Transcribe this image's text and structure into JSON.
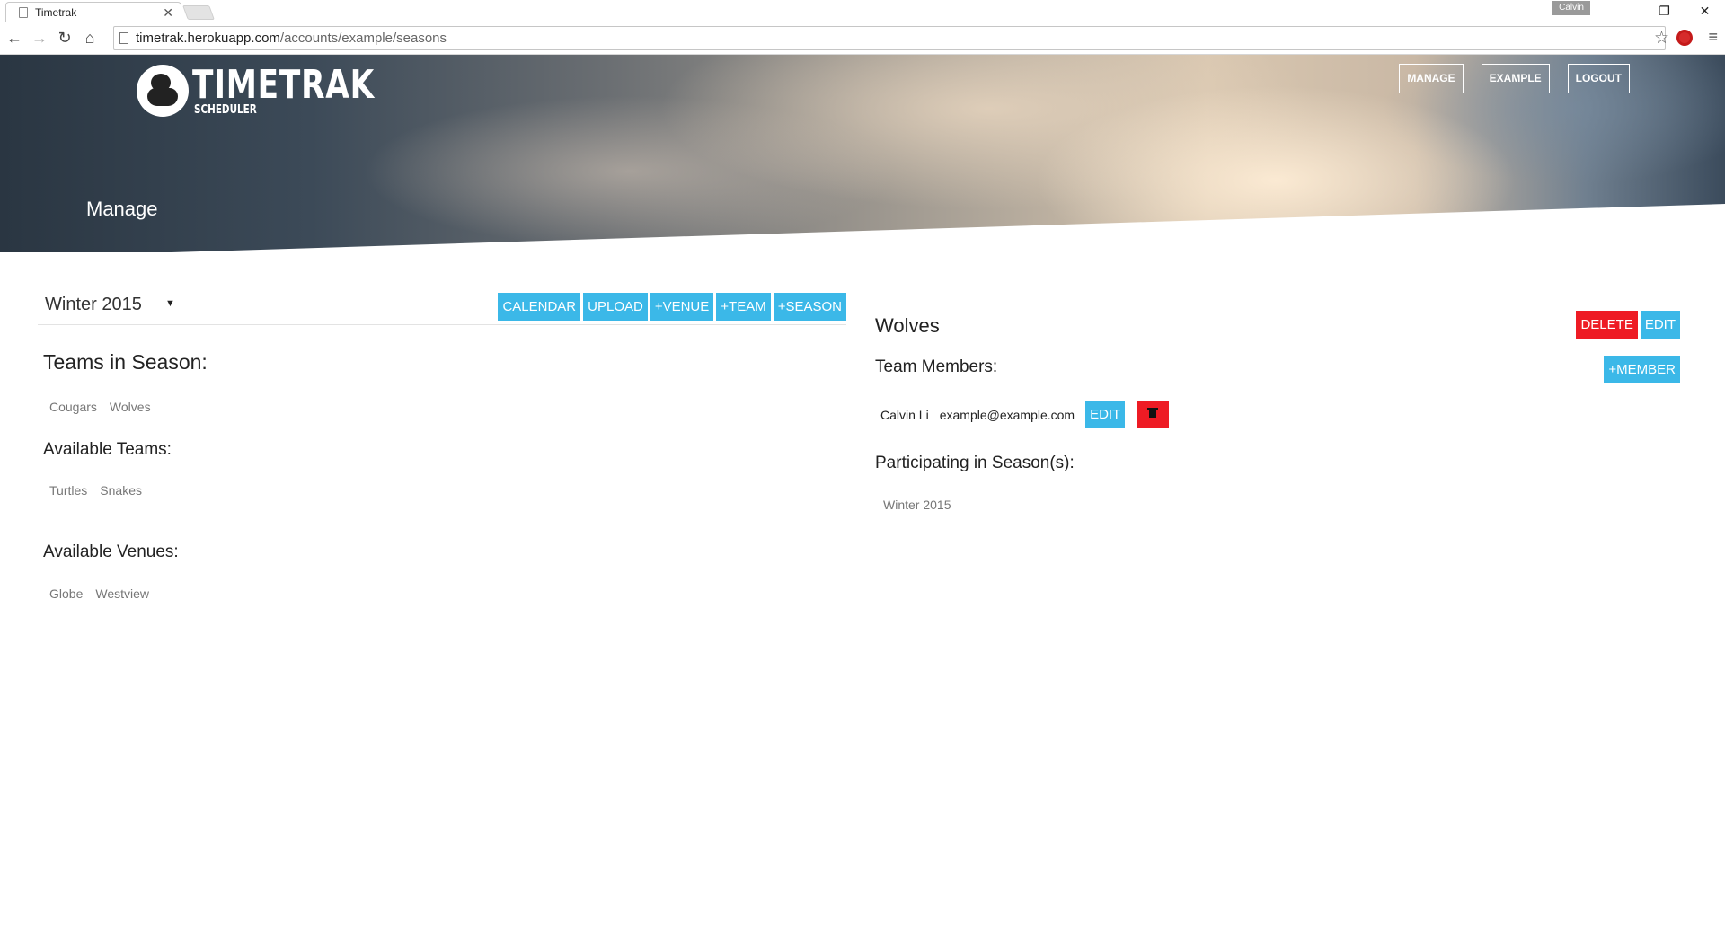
{
  "browser": {
    "tab_title": "Timetrak",
    "tab_close": "✕",
    "profile": "Calvin",
    "url_host": "timetrak.herokuapp.com",
    "url_path": "/accounts/example/seasons",
    "minimize": "—",
    "restore": "❐",
    "close": "✕"
  },
  "brand": {
    "title": "TIMETRAK",
    "subtitle": "SCHEDULER"
  },
  "nav": {
    "manage": "MANAGE",
    "example": "EXAMPLE",
    "logout": "LOGOUT"
  },
  "hero": {
    "title": "Manage"
  },
  "season": {
    "selected": "Winter 2015",
    "actions": [
      "CALENDAR",
      "UPLOAD",
      "+VENUE",
      "+TEAM",
      "+SEASON"
    ]
  },
  "left": {
    "teams_in_season_heading": "Teams in Season:",
    "teams_in_season": [
      "Cougars",
      "Wolves"
    ],
    "available_teams_heading": "Available Teams:",
    "available_teams": [
      "Turtles",
      "Snakes"
    ],
    "available_venues_heading": "Available Venues:",
    "available_venues": [
      "Globe",
      "Westview"
    ]
  },
  "team": {
    "name": "Wolves",
    "delete_label": "DELETE",
    "edit_label": "EDIT",
    "members_heading": "Team Members:",
    "add_member_label": "+MEMBER",
    "member": {
      "name": "Calvin Li",
      "email": "example@example.com",
      "edit_label": "EDIT"
    },
    "participating_heading": "Participating in Season(s):",
    "seasons": [
      "Winter 2015"
    ]
  }
}
